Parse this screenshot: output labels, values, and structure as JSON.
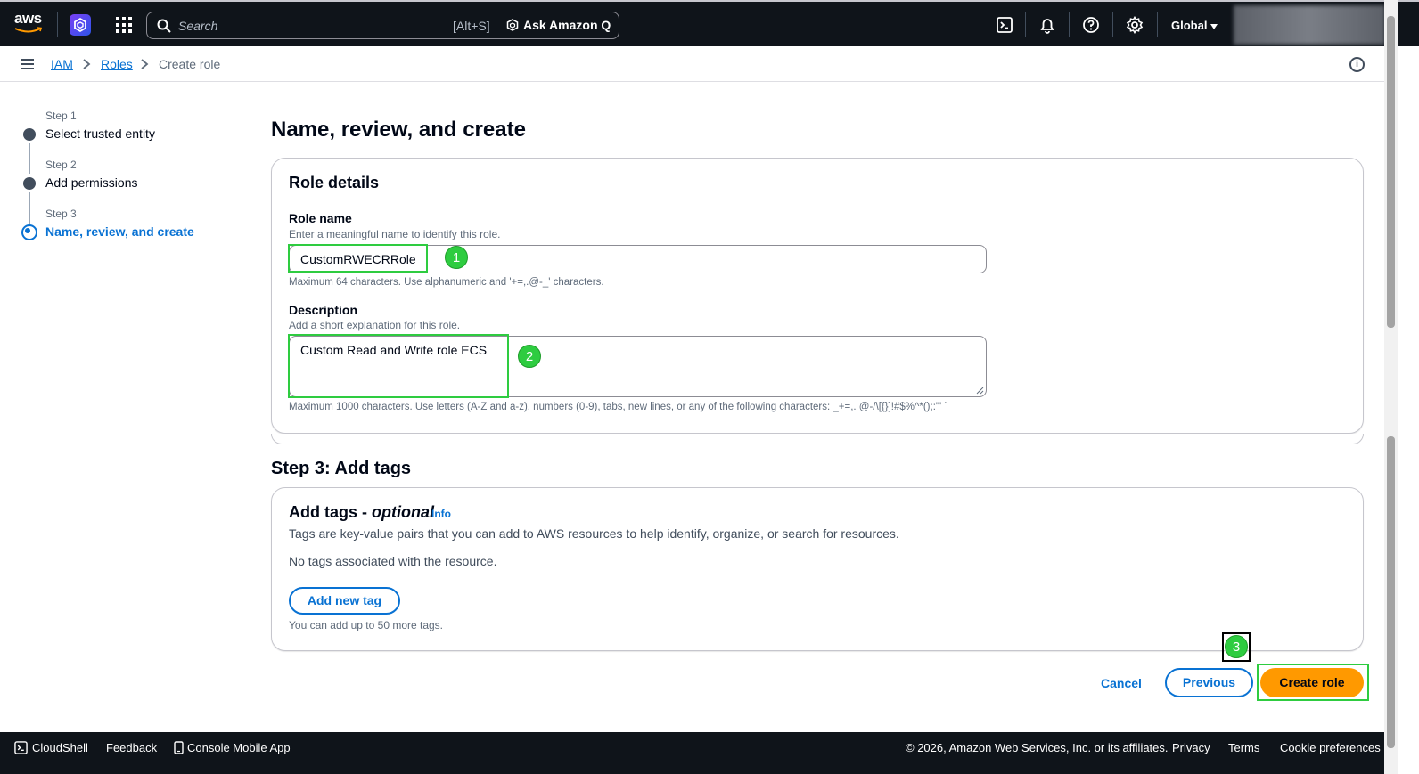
{
  "topnav": {
    "logo_text": "aws",
    "search_placeholder": "Search",
    "search_shortcut": "[Alt+S]",
    "ask_q_label": "Ask Amazon Q",
    "region_label": "Global",
    "icons": [
      "cloudshell-icon",
      "bell-icon",
      "help-icon",
      "settings-icon"
    ]
  },
  "breadcrumb": {
    "items": [
      {
        "label": "IAM",
        "link": true
      },
      {
        "label": "Roles",
        "link": true
      },
      {
        "label": "Create role",
        "link": false
      }
    ]
  },
  "wizard": {
    "steps": [
      {
        "step_label": "Step 1",
        "title": "Select trusted entity",
        "active": false
      },
      {
        "step_label": "Step 2",
        "title": "Add permissions",
        "active": false
      },
      {
        "step_label": "Step 3",
        "title": "Name, review, and create",
        "active": true
      }
    ]
  },
  "main": {
    "page_title": "Name, review, and create",
    "role_details": {
      "title": "Role details",
      "role_name_label": "Role name",
      "role_name_description": "Enter a meaningful name to identify this role.",
      "role_name_value": "CustomRWECRRole",
      "role_name_constraint": "Maximum 64 characters. Use alphanumeric and '+=,.@-_' characters.",
      "description_label": "Description",
      "description_description": "Add a short explanation for this role.",
      "description_value": "Custom Read and Write role ECS",
      "description_constraint": "Maximum 1000 characters. Use letters (A-Z and a-z), numbers (0-9), tabs, new lines, or any of the following characters: _+=,. @-/\\[{}]!#$%^*();:\"' `"
    },
    "step3_title": "Step 3: Add tags",
    "tags": {
      "title_main": "Add tags - ",
      "title_optional": "optional",
      "info_label": "Info",
      "description": "Tags are key-value pairs that you can add to AWS resources to help identify, organize, or search for resources.",
      "empty_text": "No tags associated with the resource.",
      "add_button": "Add new tag",
      "limit_text": "You can add up to 50 more tags."
    },
    "actions": {
      "cancel": "Cancel",
      "previous": "Previous",
      "create": "Create role"
    },
    "annotations": [
      "1",
      "2",
      "3"
    ]
  },
  "footer": {
    "cloudshell": "CloudShell",
    "feedback": "Feedback",
    "console_mobile_app": "Console Mobile App",
    "copyright": "© 2026, Amazon Web Services, Inc. or its affiliates.",
    "privacy": "Privacy",
    "terms": "Terms",
    "cookie_preferences": "Cookie preferences"
  },
  "colors": {
    "nav_bg": "#0f141a",
    "link_blue": "#0972d3",
    "primary_orange": "#ff9900",
    "annotation_green": "#2ecc40"
  }
}
